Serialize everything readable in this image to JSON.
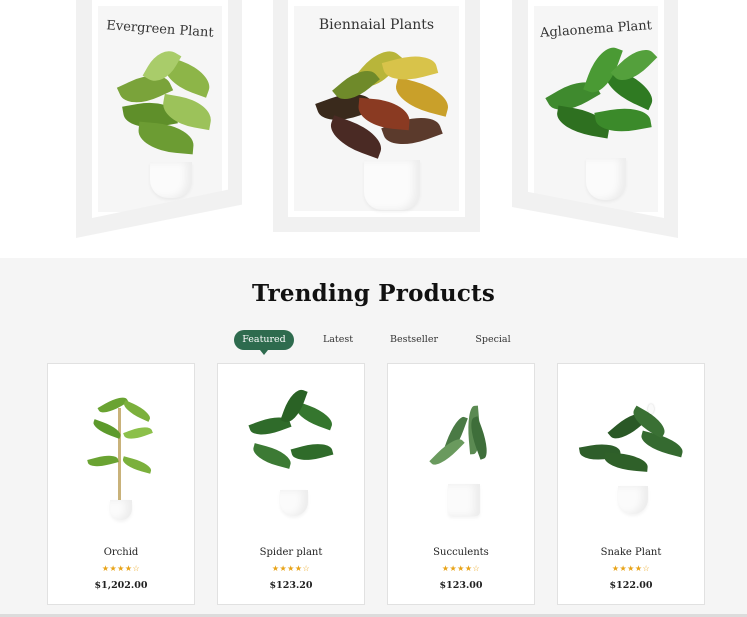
{
  "carousel": {
    "items": [
      {
        "title": "Evergreen Plant"
      },
      {
        "title": "Biennaial Plants"
      },
      {
        "title": "Aglaonema Plant"
      }
    ]
  },
  "trending": {
    "title": "Trending Products",
    "tabs": [
      "Featured",
      "Latest",
      "Bestseller",
      "Special"
    ],
    "active_tab": "Featured",
    "accent": "#2e6b4e",
    "star_color": "#e8a317",
    "products": [
      {
        "name": "Orchid",
        "rating": 4,
        "stars": "★★★★☆",
        "price": "$1,202.00"
      },
      {
        "name": "Spider plant",
        "rating": 4,
        "stars": "★★★★☆",
        "price": "$123.20"
      },
      {
        "name": "Succulents",
        "rating": 4,
        "stars": "★★★★☆",
        "price": "$123.00"
      },
      {
        "name": "Snake Plant",
        "rating": 4,
        "stars": "★★★★☆",
        "price": "$122.00"
      }
    ]
  }
}
